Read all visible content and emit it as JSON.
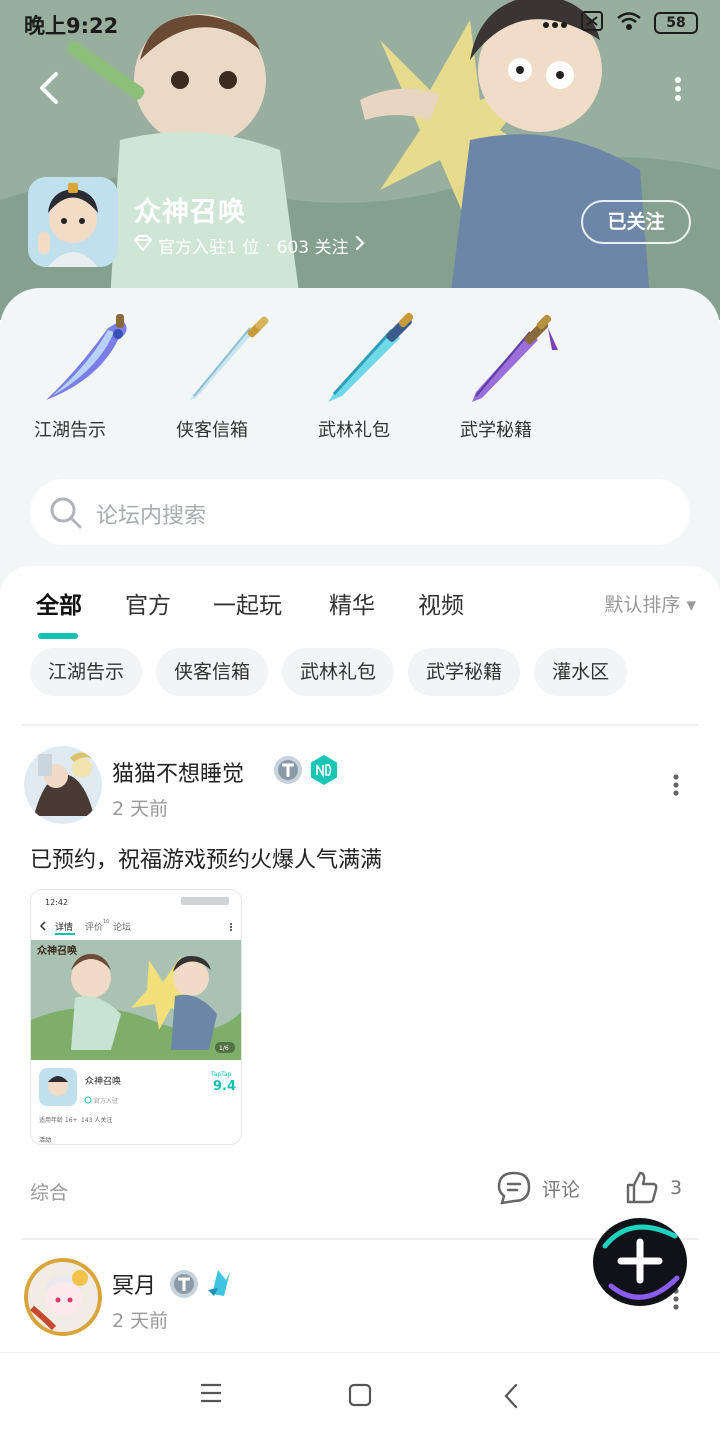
{
  "status": {
    "time": "晚上9:22",
    "battery": "58"
  },
  "header": {
    "game_title": "众神召唤",
    "meta_official": "官方入驻1 位",
    "meta_sep": "·",
    "meta_follow": "603 关注",
    "follow_button": "已关注"
  },
  "quick_links": [
    {
      "label": "江湖告示",
      "icon": "curved-blade-icon"
    },
    {
      "label": "侠客信箱",
      "icon": "sword-icon"
    },
    {
      "label": "武林礼包",
      "icon": "broadsword-icon"
    },
    {
      "label": "武学秘籍",
      "icon": "purple-sword-icon"
    }
  ],
  "search": {
    "placeholder": "论坛内搜索"
  },
  "tabs": [
    {
      "label": "全部",
      "active": true
    },
    {
      "label": "官方"
    },
    {
      "label": "一起玩"
    },
    {
      "label": "精华"
    },
    {
      "label": "视频"
    }
  ],
  "sort": {
    "label": "默认排序 ▾"
  },
  "chips": [
    "江湖告示",
    "侠客信箱",
    "武林礼包",
    "武学秘籍",
    "灌水区"
  ],
  "posts": [
    {
      "author": "猫猫不想睡觉",
      "time": "2 天前",
      "text": "已预约，祝福游戏预约火爆人气满满",
      "tag": "综合",
      "comment_label": "评论",
      "likes": "3",
      "screenshot": {
        "time": "12:42",
        "tab_detail": "详情",
        "tab_review": "评价",
        "tab_review_count": "10",
        "tab_forum": "论坛",
        "title_art": "众神召唤",
        "page_counter": "1/6",
        "game_name": "众神召唤",
        "official": "官方入驻",
        "brand": "TapTap",
        "score": "9.4",
        "age": "适用年龄 16+",
        "follows": "143 人关注",
        "activity": "活动"
      }
    },
    {
      "author": "冥月",
      "time": "2 天前"
    }
  ],
  "colors": {
    "accent": "#14c2b2",
    "hero": "#8aa396"
  }
}
